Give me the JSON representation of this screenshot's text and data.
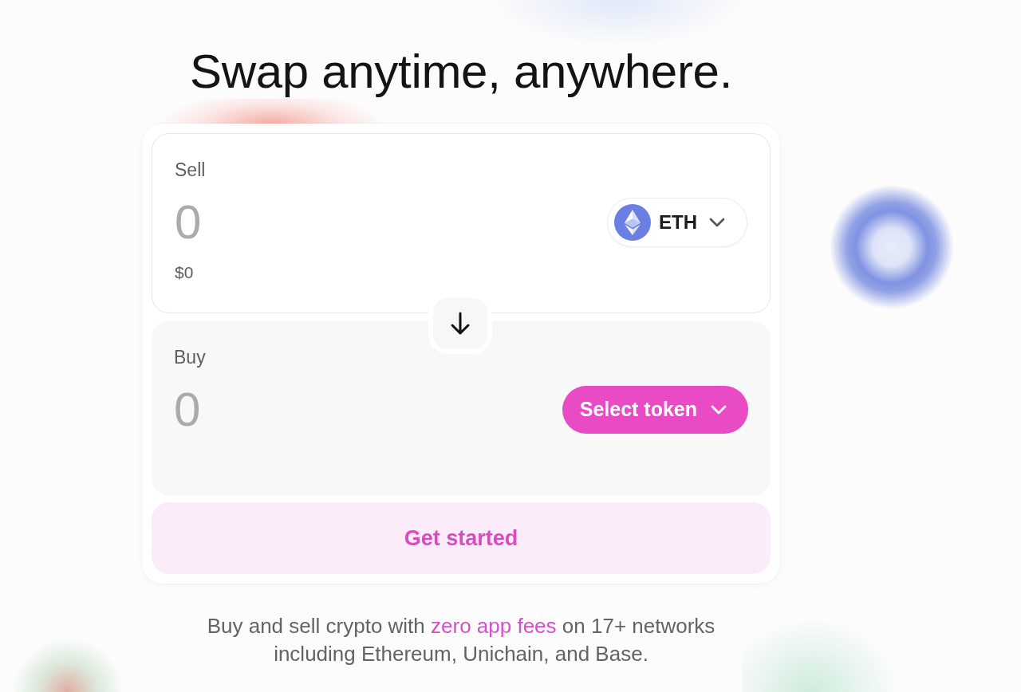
{
  "heading": "Swap anytime, anywhere.",
  "sell": {
    "label": "Sell",
    "amount": {
      "placeholder": "0"
    },
    "fiat_value": "$0",
    "token": {
      "symbol": "ETH"
    }
  },
  "buy": {
    "label": "Buy",
    "amount": {
      "placeholder": "0"
    },
    "token_button": {
      "label": "Select token"
    }
  },
  "primary_button": {
    "label": "Get started"
  },
  "footer": {
    "text_before": "Buy and sell crypto with ",
    "link": "zero app fees",
    "text_after": " on 17+ networks including Ethereum, Unichain, and Base."
  }
}
